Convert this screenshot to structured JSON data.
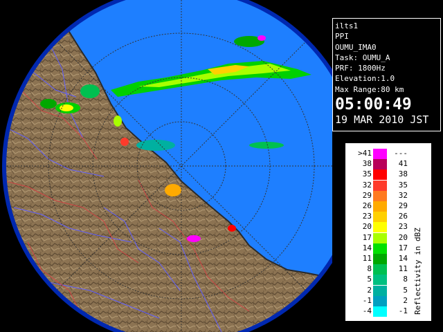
{
  "info": {
    "radar": "ilts1",
    "product": "PPI",
    "file": "OUMU_IMA0",
    "task": "Task: OUMU_A",
    "prf": "PRF: 1800Hz",
    "elevation": "Elevation:1.0",
    "max_range": "Max Range:80 km",
    "time": "05:00:49",
    "date": "19 MAR 2010 JST"
  },
  "legend": {
    "title": "Reflectivity in dBZ",
    "rows": [
      {
        "lo": ">41",
        "hi": "---",
        "color": "#ff00ff"
      },
      {
        "lo": "38",
        "hi": "41",
        "color": "#b8005a"
      },
      {
        "lo": "35",
        "hi": "38",
        "color": "#ff0000"
      },
      {
        "lo": "32",
        "hi": "35",
        "color": "#ff3b2b"
      },
      {
        "lo": "29",
        "hi": "32",
        "color": "#ff7a1f"
      },
      {
        "lo": "26",
        "hi": "29",
        "color": "#ffaa00"
      },
      {
        "lo": "23",
        "hi": "26",
        "color": "#ffd000"
      },
      {
        "lo": "20",
        "hi": "23",
        "color": "#ffff00"
      },
      {
        "lo": "17",
        "hi": "20",
        "color": "#a8ff00"
      },
      {
        "lo": "14",
        "hi": "17",
        "color": "#00e000"
      },
      {
        "lo": "11",
        "hi": "14",
        "color": "#00a800"
      },
      {
        "lo": "8",
        "hi": "11",
        "color": "#00c050"
      },
      {
        "lo": "5",
        "hi": "8",
        "color": "#00c080"
      },
      {
        "lo": "2",
        "hi": "5",
        "color": "#00b0a0"
      },
      {
        "lo": "-1",
        "hi": "2",
        "color": "#00a0c0"
      },
      {
        "lo": "-4",
        "hi": "-1",
        "color": "#00ffff"
      }
    ]
  },
  "colors": {
    "sea": "#1e7fff",
    "outer_sea": "#0033d0",
    "land": "#8a7050",
    "river": "#5a5aff",
    "border": "#c04040"
  }
}
